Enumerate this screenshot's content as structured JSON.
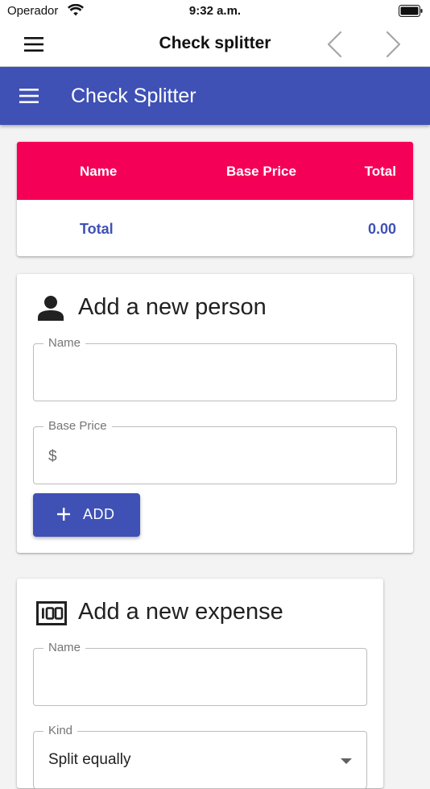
{
  "status_bar": {
    "carrier": "Operador",
    "time": "9:32 a.m."
  },
  "nav_bar": {
    "title": "Check splitter"
  },
  "app_bar": {
    "title": "Check Splitter"
  },
  "table": {
    "columns": [
      "Name",
      "Base Price",
      "Total"
    ],
    "total_label": "Total",
    "total_value": "0.00"
  },
  "person_form": {
    "title": "Add a new person",
    "name_label": "Name",
    "name_value": "",
    "base_price_label": "Base Price",
    "base_price_prefix": "$",
    "add_button_label": "ADD"
  },
  "expense_form": {
    "title": "Add a new expense",
    "name_label": "Name",
    "name_value": "",
    "kind_label": "Kind",
    "kind_value": "Split equally"
  },
  "colors": {
    "primary": "#3f51b5",
    "accent": "#f50057"
  },
  "icons": {
    "nav_menu": "hamburger-icon",
    "app_menu": "hamburger-icon",
    "person": "person-icon",
    "expense": "money-icon",
    "add": "plus-icon"
  }
}
